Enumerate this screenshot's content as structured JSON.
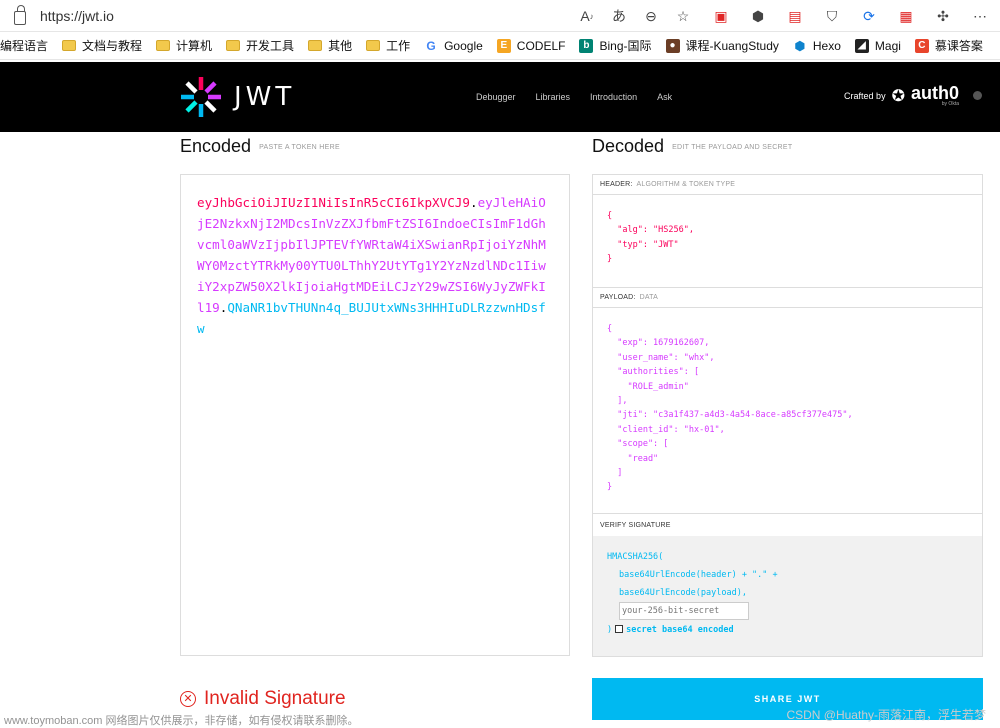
{
  "browser": {
    "url": "https://jwt.io",
    "bookmarks": [
      "编程语言",
      "文档与教程",
      "计算机",
      "开发工具",
      "其他",
      "工作",
      "Google",
      "CODELF",
      "Bing-国际",
      "课程-KuangStudy",
      "Hexo",
      "Magi",
      "慕课答案"
    ]
  },
  "header": {
    "logo_text": "JWT",
    "nav": [
      "Debugger",
      "Libraries",
      "Introduction",
      "Ask"
    ],
    "crafted_by": "Crafted by",
    "auth0": "auth0",
    "auth0_sub": "by Okta"
  },
  "encoded": {
    "title": "Encoded",
    "subtitle": "PASTE A TOKEN HERE",
    "token_header": "eyJhbGciOiJIUzI1NiIsInR5cCI6IkpXVCJ9",
    "token_payload": "eyJleHAiOjE2NzkxNjI2MDcsInVzZXJfbmFtZSI6IndoeCIsImF1dGhvcml0aWVzIjpbIlJPTEVfYWRtaW4iXSwianRpIjoiYzNhMWY0MzctYTRkMy00YTU0LThhY2UtYTg1Y2YzNzdlNDc1IiwiY2xpZW50X2lkIjoiaHgtMDEiLCJzY29wZSI6WyJyZWFkIl19",
    "token_signature": "QNaNR1bvTHUNn4q_BUJUtxWNs3HHHIuDLRzzwnHDsfw"
  },
  "decoded": {
    "title": "Decoded",
    "subtitle": "EDIT THE PAYLOAD AND SECRET",
    "header_label": "HEADER:",
    "header_label_lite": "ALGORITHM & TOKEN TYPE",
    "header_json": "{\n  \"alg\": \"HS256\",\n  \"typ\": \"JWT\"\n}",
    "payload_label": "PAYLOAD:",
    "payload_label_lite": "DATA",
    "payload_json": "{\n  \"exp\": 1679162607,\n  \"user_name\": \"whx\",\n  \"authorities\": [\n    \"ROLE_admin\"\n  ],\n  \"jti\": \"c3a1f437-a4d3-4a54-8ace-a85cf377e475\",\n  \"client_id\": \"hx-01\",\n  \"scope\": [\n    \"read\"\n  ]\n}",
    "verify_label": "VERIFY SIGNATURE",
    "verify_line1": "HMACSHA256(",
    "verify_line2": "base64UrlEncode(header) + \".\" +",
    "verify_line3": "base64UrlEncode(payload),",
    "secret_placeholder": "your-256-bit-secret",
    "verify_close": ")",
    "secret_b64_label": "secret base64 encoded"
  },
  "status": {
    "invalid_text": "Invalid Signature",
    "share_button": "SHARE JWT"
  },
  "watermarks": {
    "left": "www.toymoban.com 网络图片仅供展示，非存储，如有侵权请联系删除。",
    "right": "CSDN @Huathy-雨落江南，浮生若梦"
  },
  "colors": {
    "header_red": "#fb015b",
    "payload_purple": "#d63aff",
    "signature_blue": "#00b9f1",
    "invalid_red": "#e0241f"
  }
}
